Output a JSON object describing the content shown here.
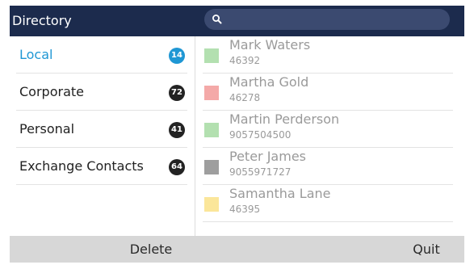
{
  "header": {
    "title": "Directory",
    "search_placeholder": ""
  },
  "folders": [
    {
      "label": "Local",
      "count": "14",
      "selected": true
    },
    {
      "label": "Corporate",
      "count": "72",
      "selected": false
    },
    {
      "label": "Personal",
      "count": "41",
      "selected": false
    },
    {
      "label": "Exchange Contacts",
      "count": "64",
      "selected": false
    }
  ],
  "contacts": [
    {
      "name": "Mark Waters",
      "number": "46392",
      "color": "#b3e0b0"
    },
    {
      "name": "Martha Gold",
      "number": "46278",
      "color": "#f4a9a8"
    },
    {
      "name": "Martin Perderson",
      "number": "9057504500",
      "color": "#b3e0b0"
    },
    {
      "name": "Peter James",
      "number": "9055971727",
      "color": "#9e9e9e"
    },
    {
      "name": "Samantha Lane",
      "number": "46395",
      "color": "#fbe69a"
    }
  ],
  "footer": {
    "delete_label": "Delete",
    "quit_label": "Quit"
  },
  "colors": {
    "header_bg": "#1c2b4d",
    "accent": "#1f97d4",
    "badge": "#232323",
    "footer_bg": "#d7d7d7"
  },
  "icons": {
    "search": "search-icon"
  }
}
